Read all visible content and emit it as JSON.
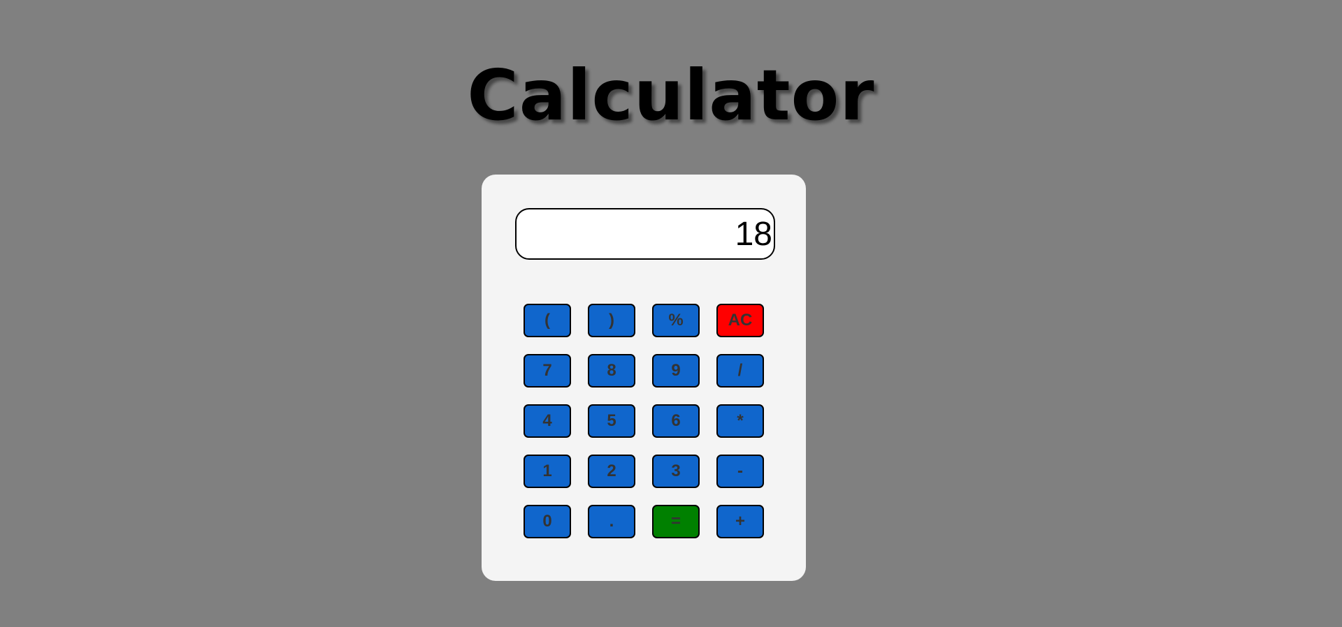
{
  "title": "Calculator",
  "display": {
    "value": "18"
  },
  "colors": {
    "background": "#808080",
    "body": "#f4f4f4",
    "key": "#1066cc",
    "clear_key": "#ff0000",
    "equals_key": "#008000",
    "key_text": "#333333"
  },
  "keys": {
    "open_paren": "(",
    "close_paren": ")",
    "percent": "%",
    "clear": "AC",
    "seven": "7",
    "eight": "8",
    "nine": "9",
    "divide": "/",
    "four": "4",
    "five": "5",
    "six": "6",
    "multiply": "*",
    "one": "1",
    "two": "2",
    "three": "3",
    "subtract": "-",
    "zero": "0",
    "decimal": ".",
    "equals": "=",
    "add": "+"
  }
}
